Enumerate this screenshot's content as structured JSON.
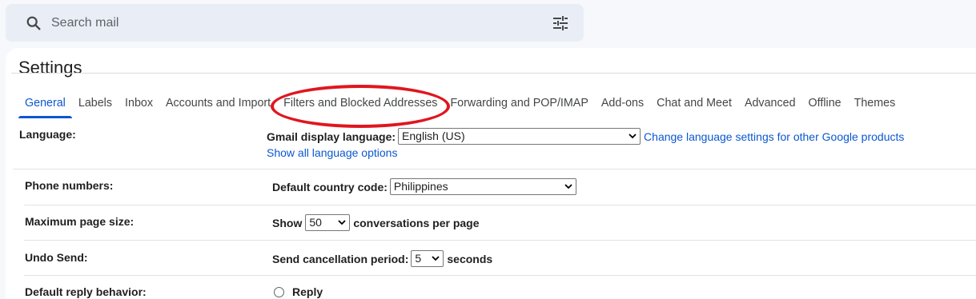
{
  "search": {
    "placeholder": "Search mail"
  },
  "page_title": "Settings",
  "tabs": [
    {
      "label": "General",
      "active": true
    },
    {
      "label": "Labels"
    },
    {
      "label": "Inbox"
    },
    {
      "label": "Accounts and Import"
    },
    {
      "label": "Filters and Blocked Addresses",
      "highlighted": true
    },
    {
      "label": "Forwarding and POP/IMAP"
    },
    {
      "label": "Add-ons"
    },
    {
      "label": "Chat and Meet"
    },
    {
      "label": "Advanced"
    },
    {
      "label": "Offline"
    },
    {
      "label": "Themes"
    }
  ],
  "settings": {
    "language": {
      "label": "Language:",
      "field_label": "Gmail display language:",
      "value": "English (US)",
      "link": "Change language settings for other Google products",
      "show_all": "Show all language options"
    },
    "phone": {
      "label": "Phone numbers:",
      "field_label": "Default country code:",
      "value": "Philippines"
    },
    "page_size": {
      "label": "Maximum page size:",
      "prefix": "Show",
      "value": "50",
      "suffix": "conversations per page"
    },
    "undo_send": {
      "label": "Undo Send:",
      "field_label": "Send cancellation period:",
      "value": "5",
      "suffix": "seconds"
    },
    "reply": {
      "label": "Default reply behavior:",
      "option": "Reply"
    }
  },
  "colors": {
    "accent": "#0b57d0",
    "highlight": "#e0161f",
    "background": "#f6f8fc"
  }
}
